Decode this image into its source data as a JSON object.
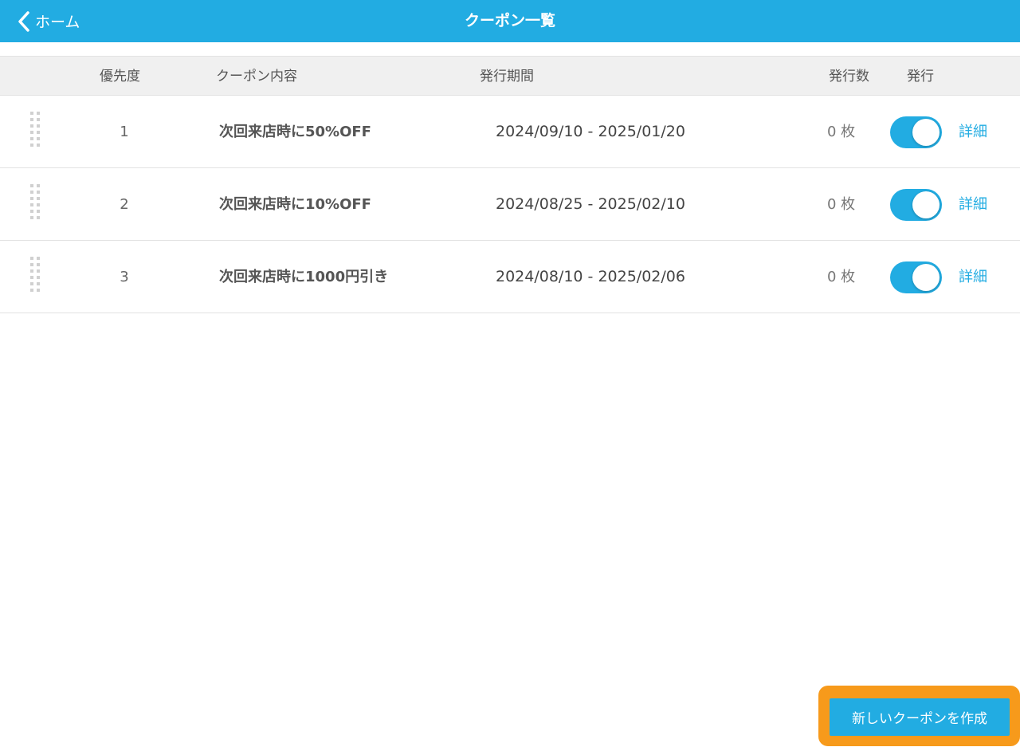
{
  "navbar": {
    "back_label": "ホーム",
    "title": "クーポン一覧",
    "color": "#22ace2"
  },
  "table": {
    "headers": {
      "priority": "優先度",
      "content": "クーポン内容",
      "period": "発行期間",
      "count": "発行数",
      "issue": "発行"
    },
    "rows": [
      {
        "priority": "1",
        "content": "次回来店時に50%OFF",
        "period": "2024/09/10 - 2025/01/20",
        "count": "0 枚",
        "issue_enabled": true,
        "detail_label": "詳細"
      },
      {
        "priority": "2",
        "content": "次回来店時に10%OFF",
        "period": "2024/08/25 - 2025/02/10",
        "count": "0 枚",
        "issue_enabled": true,
        "detail_label": "詳細"
      },
      {
        "priority": "3",
        "content": "次回来店時に1000円引き",
        "period": "2024/08/10 - 2025/02/06",
        "count": "0 枚",
        "issue_enabled": true,
        "detail_label": "詳細"
      }
    ]
  },
  "create_button": {
    "label": "新しいクーポンを作成",
    "highlight_color": "#f79a1b"
  },
  "icons": {
    "back": "chevron-left-icon",
    "drag": "drag-handle-icon"
  }
}
